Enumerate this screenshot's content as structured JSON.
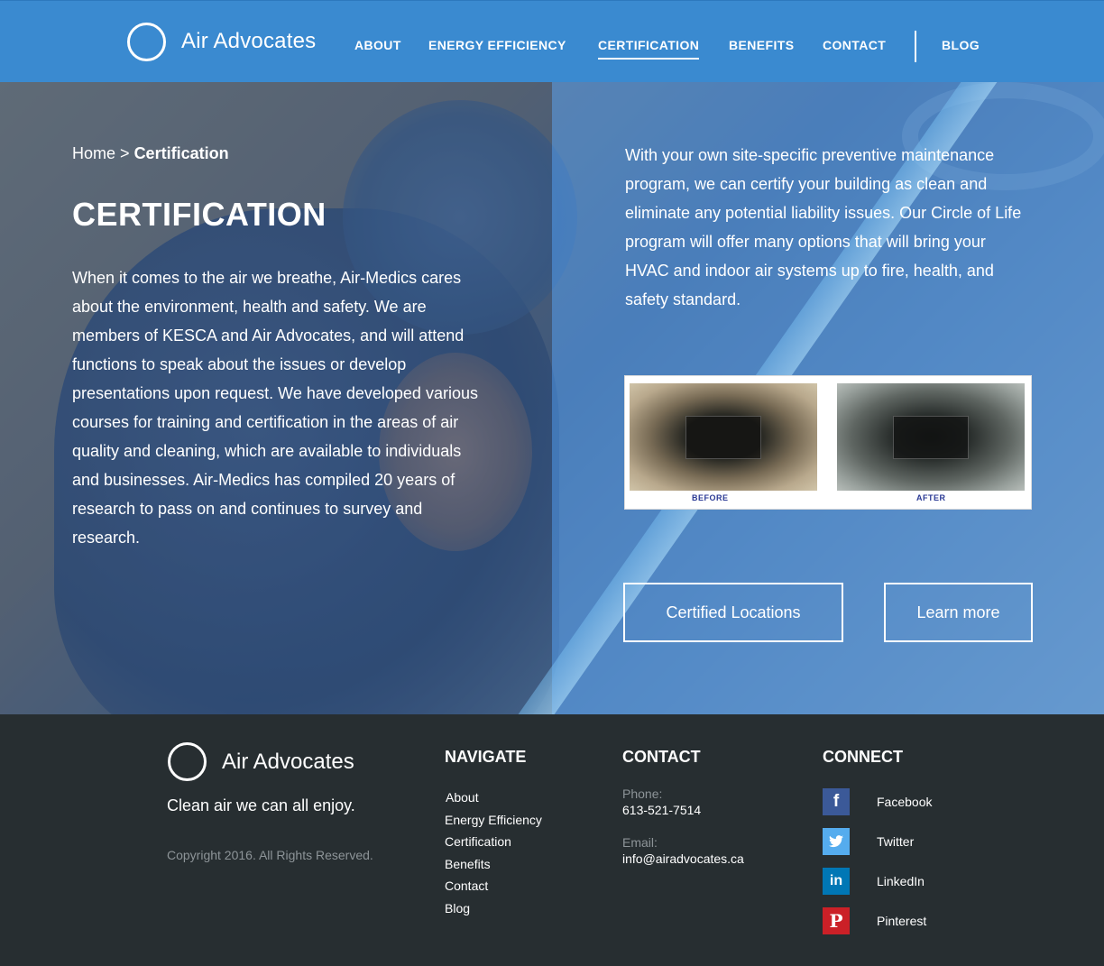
{
  "header": {
    "brand": "Air Advocates",
    "nav": [
      {
        "label": "ABOUT"
      },
      {
        "label": "ENERGY EFFICIENCY"
      },
      {
        "label": "CERTIFICATION"
      },
      {
        "label": "BENEFITS"
      },
      {
        "label": "CONTACT"
      },
      {
        "label": "BLOG"
      }
    ],
    "active": "CERTIFICATION"
  },
  "hero": {
    "breadcrumb": {
      "home": "Home",
      "separator": ">",
      "current": "Certification"
    },
    "title": "CERTIFICATION",
    "body": "When it comes to the air we breathe, Air-Medics cares about the environment, health and safety. We are members of KESCA and Air Advocates, and will attend functions to speak about the issues or develop presentations upon request.  We have developed various courses for training and certification in the areas of air quality and cleaning, which are available to individuals and businesses. Air-Medics has compiled 20 years of research to pass on and continues to survey and research.",
    "right_text": "With your own site-specific preventive maintenance program, we can certify your building as clean and eliminate any potential liability issues. Our Circle of Life program will offer many options that will bring your HVAC and indoor air systems up to fire, health, and safety standard.",
    "before_label": "BEFORE",
    "after_label": "AFTER",
    "buttons": {
      "locations": "Certified Locations",
      "learn": "Learn more"
    }
  },
  "footer": {
    "brand": "Air Advocates",
    "tagline": "Clean air we can all enjoy.",
    "copyright": "Copyright 2016. All Rights Reserved.",
    "navigate_heading": "NAVIGATE",
    "navigate": [
      "About",
      "Energy Efficiency",
      "Certification",
      "Benefits",
      "Contact",
      "Blog"
    ],
    "contact_heading": "CONTACT",
    "phone_label": "Phone:",
    "phone": "613-521-7514",
    "email_label": "Email:",
    "email": "info@airadvocates.ca",
    "connect_heading": "CONNECT",
    "social": [
      {
        "name": "Facebook",
        "icon": "facebook-icon",
        "glyph": "f",
        "color": "#3b5998"
      },
      {
        "name": "Twitter",
        "icon": "twitter-icon",
        "glyph": "t",
        "color": "#55acee"
      },
      {
        "name": "LinkedIn",
        "icon": "linkedin-icon",
        "glyph": "in",
        "color": "#0077b5"
      },
      {
        "name": "Pinterest",
        "icon": "pinterest-icon",
        "glyph": "P",
        "color": "#cb2027"
      }
    ]
  },
  "colors": {
    "header_bg": "#3a8ad0",
    "footer_bg": "#272e31",
    "muted_text": "#8d9498"
  }
}
